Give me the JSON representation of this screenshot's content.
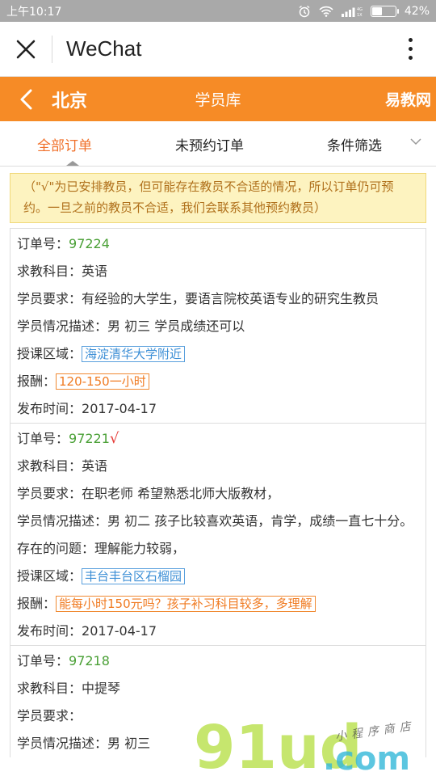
{
  "status_bar": {
    "time": "上午10:17",
    "battery": "42%",
    "battery_level": 0.42
  },
  "wechat": {
    "title": "WeChat"
  },
  "header": {
    "city": "北京",
    "title": "学员库",
    "brand": "易教网"
  },
  "tabs": [
    {
      "label": "全部订单",
      "active": true
    },
    {
      "label": "未预约订单",
      "active": false
    },
    {
      "label": "条件筛选",
      "active": false
    }
  ],
  "notice": "（\"√\"为已安排教员，但可能存在教员不合适的情况，所以订单仍可预约。一旦之前的教员不合适，我们会联系其他预约教员）",
  "labels": {
    "order_no": "订单号：",
    "subject": "求教科目：",
    "requirement": "学员要求：",
    "description": "学员情况描述：",
    "area": "授课区域：",
    "fee": "报酬：",
    "published": "发布时间："
  },
  "orders": [
    {
      "id": "97224",
      "subject": "英语",
      "requirement": "有经验的大学生，要语言院校英语专业的研究生教员",
      "description": "男 初三 学员成绩还可以",
      "area": "海淀清华大学附近",
      "fee": "120-150一小时",
      "published": "2017-04-17"
    },
    {
      "id": "97221",
      "check": "√",
      "subject": "英语",
      "requirement": "在职老师 希望熟悉北师大版教材，",
      "description": "男 初二 孩子比较喜欢英语，肯学，成绩一直七十分。存在的问题：理解能力较弱，",
      "area": "丰台丰台区石榴园",
      "fee": "能每小时150元吗？孩子补习科目较多，多理解",
      "published": "2017-04-17"
    },
    {
      "id": "97218",
      "subject": "中提琴",
      "requirement": "",
      "description": "男 初三"
    }
  ],
  "watermark": {
    "logo": "91ud",
    "tld": ".com",
    "slogan": "小程序商店"
  },
  "colors": {
    "accent": "#f68b26",
    "order_id": "#4aa036",
    "area": "#3d8fd6",
    "fee": "#f07a20",
    "check": "#e53935"
  }
}
